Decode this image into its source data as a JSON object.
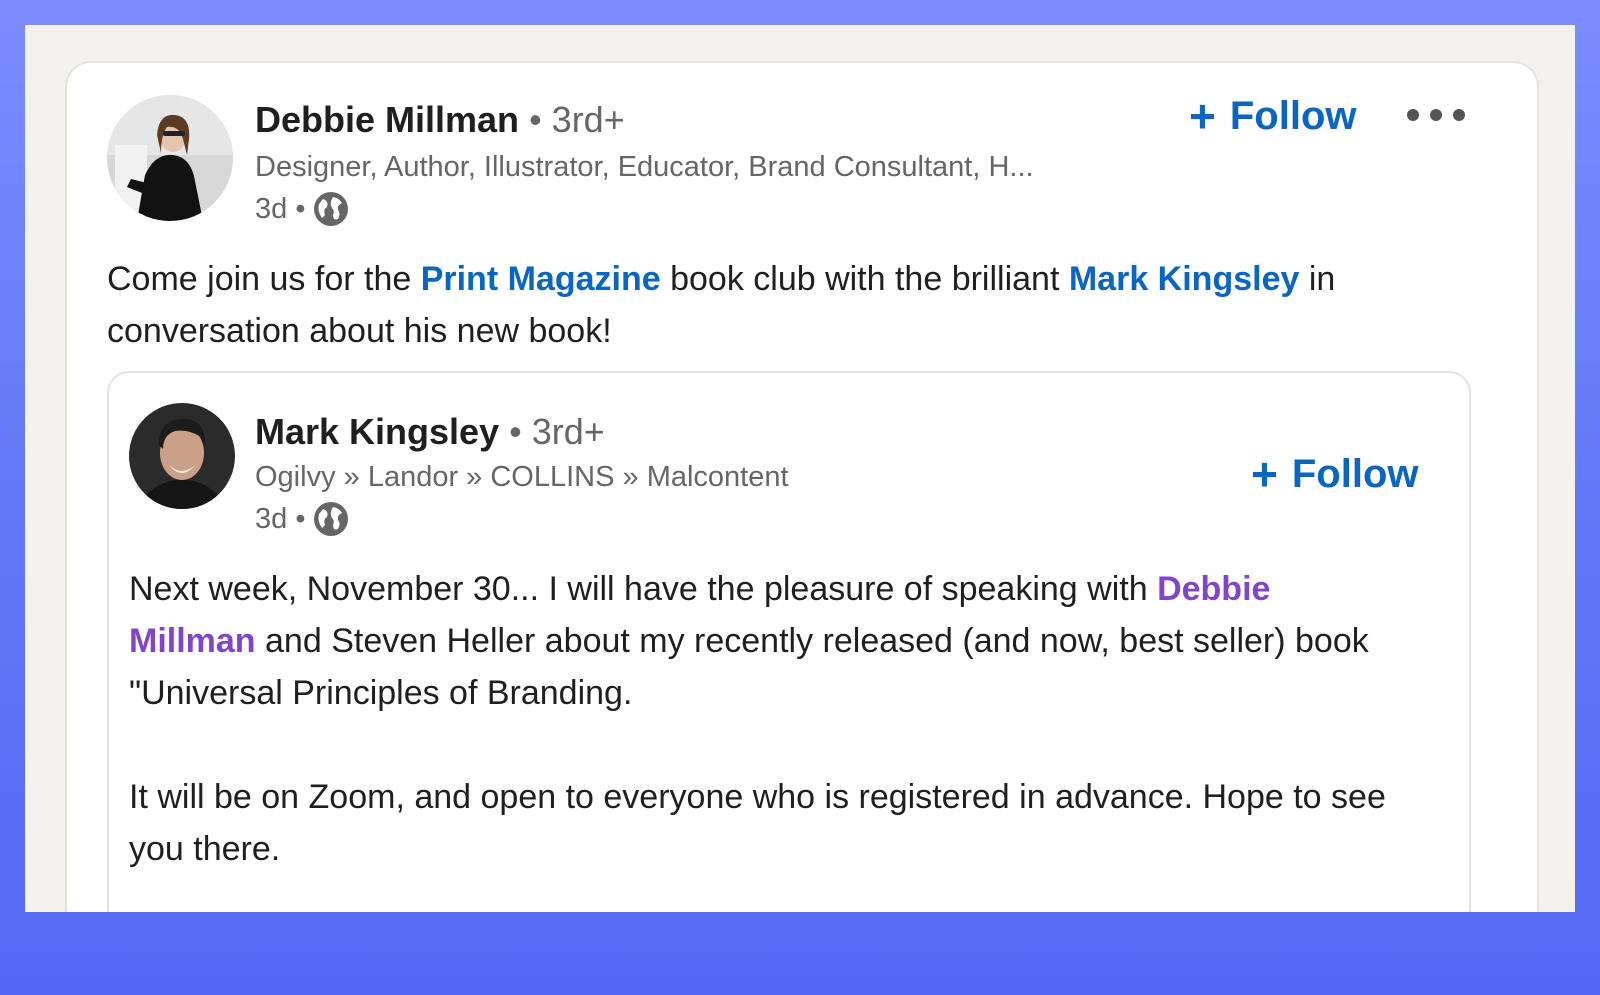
{
  "post": {
    "author": {
      "name": "Debbie Millman",
      "degree": "• 3rd+",
      "headline": "Designer, Author, Illustrator, Educator, Brand Consultant, H...",
      "time": "3d •"
    },
    "follow_label": "Follow",
    "follow_icon": "plus-icon",
    "more_icon": "ellipsis-icon",
    "text": {
      "before": "Come join us for the ",
      "mention1": "Print Magazine",
      "middle": " book club with the brilliant ",
      "mention2": "Mark Kingsley",
      "after": " in conversation about his new book!"
    }
  },
  "reshared": {
    "author": {
      "name": "Mark Kingsley",
      "degree": "• 3rd+",
      "headline": "Ogilvy » Landor » COLLINS » Malcontent",
      "time": "3d •"
    },
    "follow_label": "Follow",
    "text": {
      "before": "Next week, November 30... I will have the pleasure of speaking with ",
      "mention": "Debbie Millman",
      "after": " and Steven Heller about my recently released (and now, best seller) book \"Universal Principles of Branding.",
      "paragraph2": "It will be on Zoom, and open to everyone who is registered in advance. Hope to see you there."
    }
  },
  "colors": {
    "link": "#0a66c2",
    "mention_visited": "#8344cc",
    "background": "#5c70f5"
  }
}
